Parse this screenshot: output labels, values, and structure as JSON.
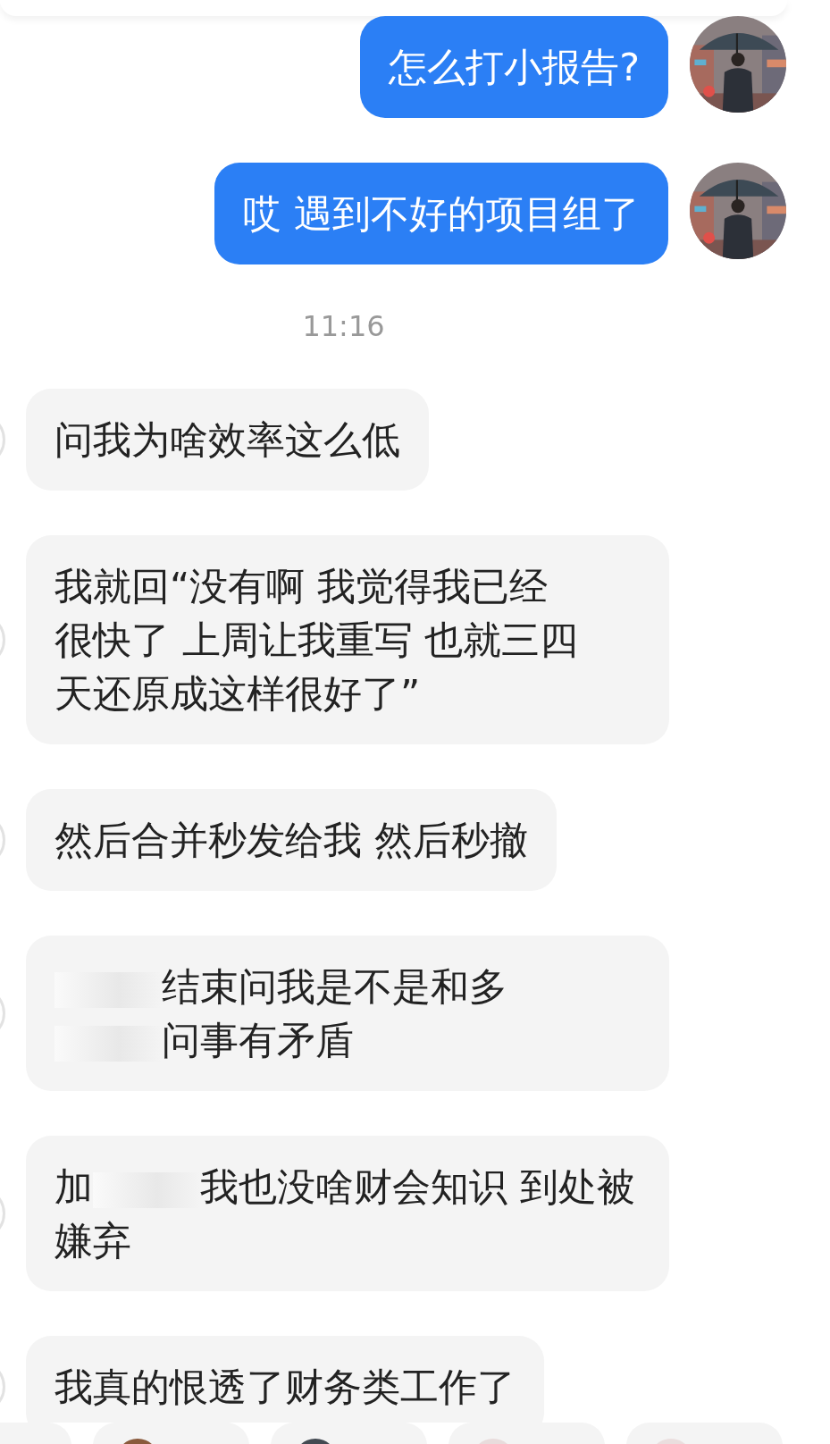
{
  "messages": [
    {
      "kind": "outgoing",
      "parts": [
        {
          "kind": "text",
          "text": "怎么打小报告?"
        }
      ]
    },
    {
      "kind": "outgoing",
      "parts": [
        {
          "kind": "text",
          "text": "哎 遇到不好的项目组了"
        }
      ]
    },
    {
      "kind": "time",
      "parts": [
        {
          "kind": "text",
          "text": "11:16"
        }
      ]
    },
    {
      "kind": "incoming",
      "parts": [
        {
          "kind": "text",
          "text": "问我为啥效率这么低"
        }
      ]
    },
    {
      "kind": "incoming",
      "parts": [
        {
          "kind": "text",
          "text": "我就回“没有啊 我觉得我已经"
        },
        {
          "kind": "break"
        },
        {
          "kind": "text",
          "text": "很快了 上周让我重写 也就三四"
        },
        {
          "kind": "break"
        },
        {
          "kind": "text",
          "text": "天还原成这样很好了”"
        }
      ]
    },
    {
      "kind": "incoming",
      "parts": [
        {
          "kind": "text",
          "text": "然后合并秒发给我 然后秒撤"
        }
      ]
    },
    {
      "kind": "incoming",
      "parts": [
        {
          "kind": "redaction"
        },
        {
          "kind": "text",
          "text": "结束问我是不是和多"
        },
        {
          "kind": "break"
        },
        {
          "kind": "redaction"
        },
        {
          "kind": "text",
          "text": "问事有矛盾"
        }
      ]
    },
    {
      "kind": "incoming",
      "parts": [
        {
          "kind": "text",
          "text": "加"
        },
        {
          "kind": "redaction"
        },
        {
          "kind": "text",
          "text": "我也没啥财会知识 到处被"
        },
        {
          "kind": "break"
        },
        {
          "kind": "text",
          "text": "嫌弃"
        }
      ]
    },
    {
      "kind": "incoming",
      "parts": [
        {
          "kind": "text",
          "text": "我真的恨透了财务类工作了"
        }
      ]
    }
  ],
  "quick_replies": [
    {
      "kind": "plain"
    },
    {
      "kind": "sticker"
    },
    {
      "kind": "sticker"
    },
    {
      "kind": "sticker"
    },
    {
      "kind": "sticker"
    }
  ]
}
